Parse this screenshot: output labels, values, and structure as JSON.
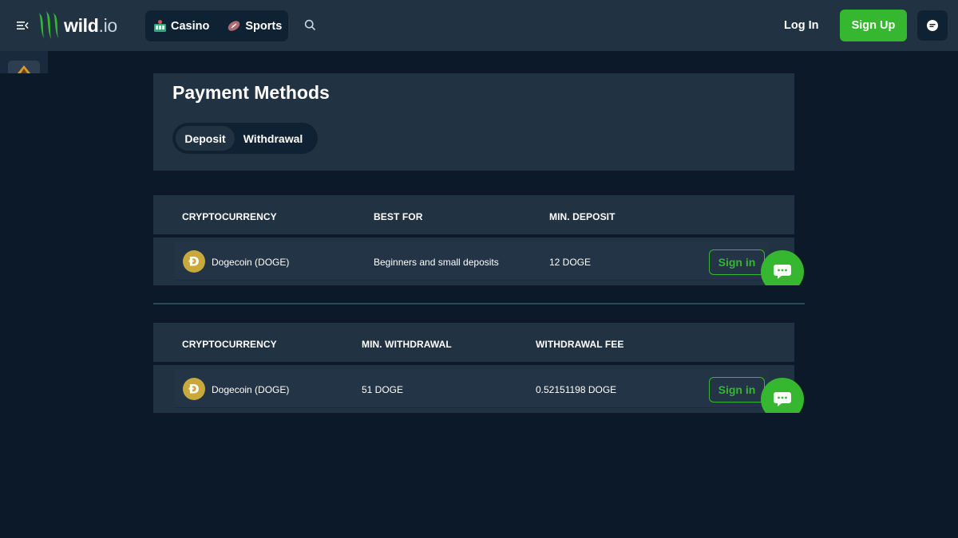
{
  "header": {
    "logo_main": "wild",
    "logo_suffix": ".io",
    "nav": [
      {
        "label": "Casino",
        "icon": "casino-icon"
      },
      {
        "label": "Sports",
        "icon": "football-icon"
      }
    ],
    "login_label": "Log In",
    "signup_label": "Sign Up"
  },
  "colors": {
    "accent": "#35b82f",
    "background": "#0b1929",
    "panel": "#213243",
    "coin": "#c9a93b"
  },
  "payment": {
    "title": "Payment Methods",
    "tabs": [
      {
        "label": "Deposit",
        "active": true
      },
      {
        "label": "Withdrawal",
        "active": false
      }
    ]
  },
  "deposit_table": {
    "columns": [
      "CRYPTOCURRENCY",
      "BEST FOR",
      "MIN. DEPOSIT"
    ],
    "rows": [
      {
        "coin_symbol": "Ð",
        "currency": "Dogecoin (DOGE)",
        "best_for": "Beginners and small deposits",
        "min_deposit": "12 DOGE",
        "action": "Sign in"
      }
    ]
  },
  "withdrawal_table": {
    "columns": [
      "CRYPTOCURRENCY",
      "MIN. WITHDRAWAL",
      "WITHDRAWAL FEE"
    ],
    "rows": [
      {
        "coin_symbol": "Ð",
        "currency": "Dogecoin (DOGE)",
        "min_withdrawal": "51 DOGE",
        "withdrawal_fee": "0.52151198 DOGE",
        "action": "Sign in"
      }
    ]
  }
}
